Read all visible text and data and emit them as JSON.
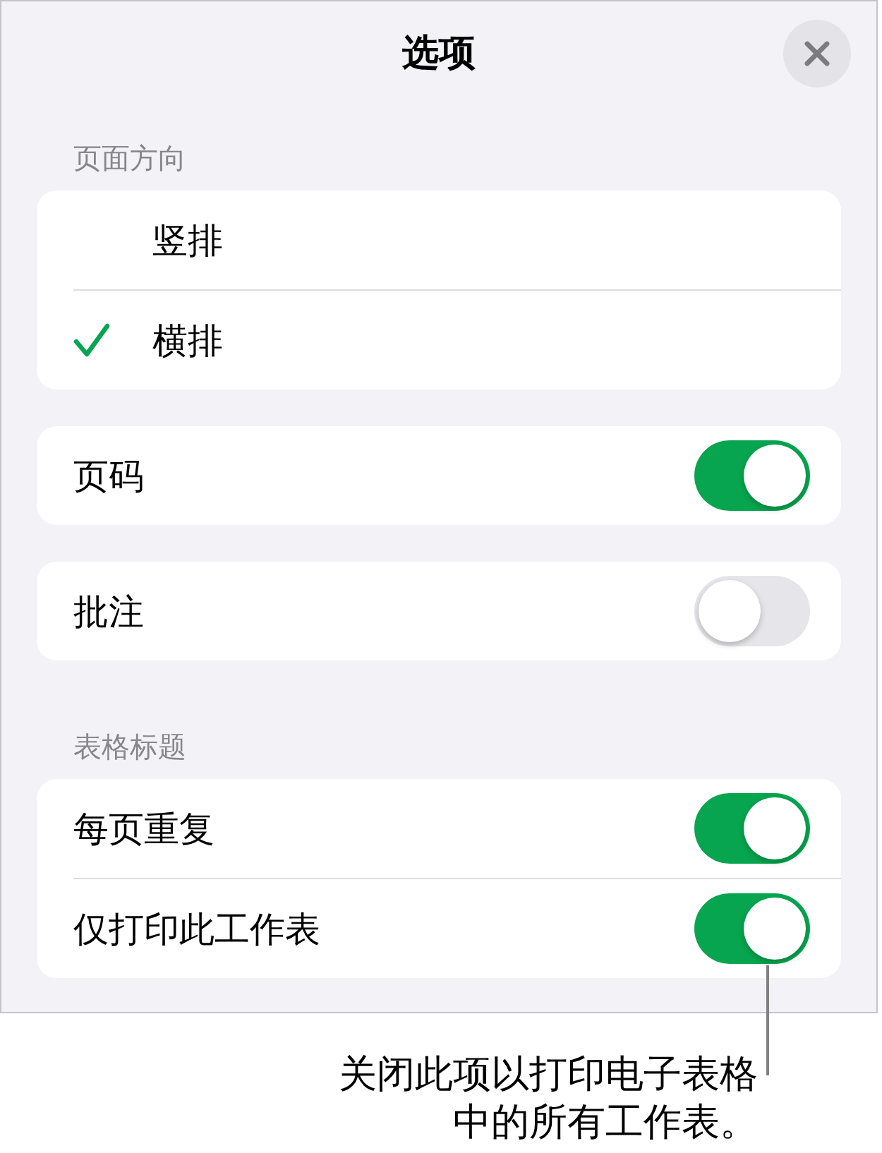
{
  "sheet": {
    "title": "选项"
  },
  "groups": [
    {
      "header": "页面方向",
      "rows": [
        {
          "kind": "choice",
          "label": "竖排",
          "selected": false
        },
        {
          "kind": "choice",
          "label": "横排",
          "selected": true
        }
      ]
    },
    {
      "rows": [
        {
          "kind": "toggle",
          "label": "页码",
          "on": true
        }
      ]
    },
    {
      "rows": [
        {
          "kind": "toggle",
          "label": "批注",
          "on": false
        }
      ]
    },
    {
      "header": "表格标题",
      "rows": [
        {
          "kind": "toggle",
          "label": "每页重复",
          "on": true
        },
        {
          "kind": "toggle",
          "label": "仅打印此工作表",
          "on": true
        }
      ]
    }
  ],
  "callout": {
    "text": "关闭此项以打印电子表格中的所有工作表。"
  }
}
